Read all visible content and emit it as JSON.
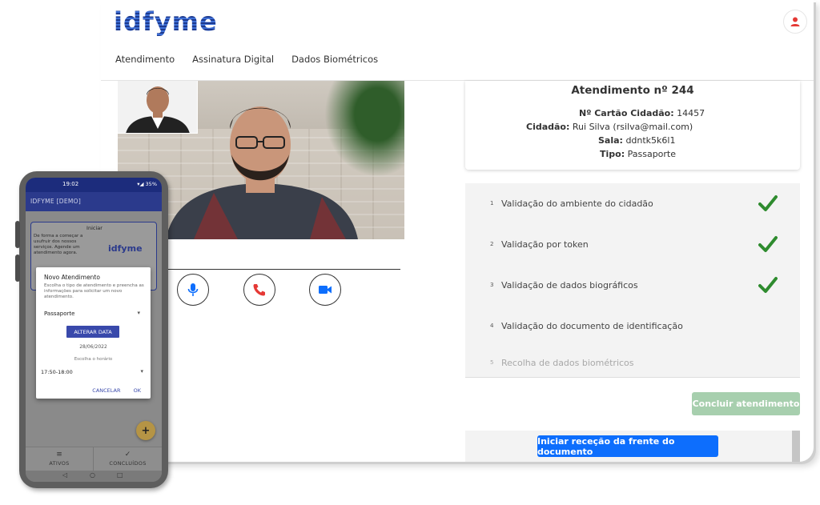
{
  "app": {
    "logo": "idfyme"
  },
  "nav": {
    "items": [
      "Atendimento",
      "Assinatura Digital",
      "Dados Biométricos"
    ]
  },
  "call": {
    "mic_icon": "microphone-icon",
    "hangup_icon": "phone-hangup-icon",
    "video_icon": "video-camera-icon"
  },
  "attendance": {
    "title": "Atendimento nº 244",
    "card_label": "Nº Cartão Cidadão:",
    "card_value": "14457",
    "citizen_label": "Cidadão:",
    "citizen_value": "Rui Silva (rsilva@mail.com)",
    "room_label": "Sala:",
    "room_value": "ddntk5k6l1",
    "type_label": "Tipo:",
    "type_value": "Passaporte"
  },
  "steps": [
    {
      "num": "1",
      "label": "Validação do ambiente do cidadão",
      "done": true
    },
    {
      "num": "2",
      "label": "Validação por token",
      "done": true
    },
    {
      "num": "3",
      "label": "Validação de dados biográficos",
      "done": true
    },
    {
      "num": "4",
      "label": "Validação do documento de identificação",
      "done": false
    },
    {
      "num": "5",
      "label": "Recolha de dados biométricos",
      "done": false
    }
  ],
  "buttons": {
    "concluir": "Concluir atendimento",
    "iniciar": "Iniciar receção da frente do documento"
  },
  "colors": {
    "primary": "#0d6efd",
    "success": "#2e8b2e",
    "concluir_disabled": "#a7cfae",
    "brand": "#1d3a8f"
  },
  "phone": {
    "time": "19:02",
    "battery": "35%",
    "app_title": "IDFYME [DEMO]",
    "start_card_title": "Iniciar",
    "start_card_desc": "De forma a começar a usufruir dos nossos serviços. Agende um atendimento agora.",
    "start_card_logo": "idfyme",
    "dialog": {
      "title": "Novo Atendimento",
      "desc": "Escolha o tipo de atendimento e preencha as informações para solicitar um novo atendimento.",
      "type_selected": "Passaporte",
      "change_date": "ALTERAR DATA",
      "date": "28/06/2022",
      "time_hint": "Escolha o horário",
      "time_selected": "17:50-18:00",
      "cancel": "CANCELAR",
      "ok": "OK"
    },
    "fab": "+",
    "tabs": [
      {
        "icon": "≡",
        "label": "ATIVOS"
      },
      {
        "icon": "✓",
        "label": "CONCLUÍDOS"
      }
    ],
    "sysnav": [
      "◁",
      "○",
      "□"
    ]
  }
}
